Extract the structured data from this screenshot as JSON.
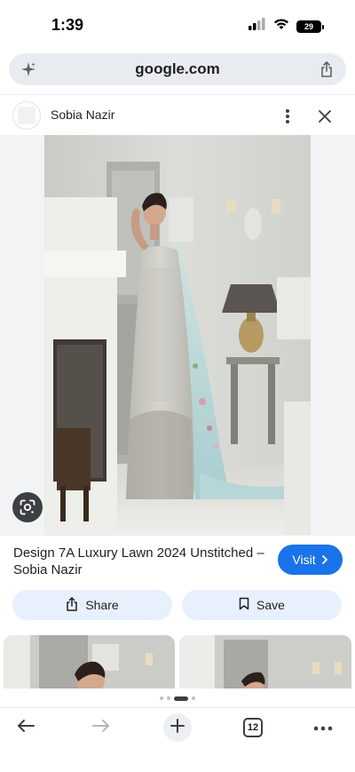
{
  "status_bar": {
    "time": "1:39",
    "battery": "29"
  },
  "url_bar": {
    "url": "google.com",
    "left_icon": "sparkle-icon",
    "right_icon": "share-icon"
  },
  "source": {
    "name": "Sobia Nazir"
  },
  "result": {
    "title": "Design 7A Luxury Lawn 2024 Unstitched – Sobia Nazir",
    "visit_label": "Visit"
  },
  "actions": {
    "share_label": "Share",
    "save_label": "Save"
  },
  "toolbar": {
    "tab_count": "12"
  },
  "colors": {
    "accent": "#1a73e8",
    "pill_bg": "#e8f0fe",
    "url_bg": "#e8ebf0"
  }
}
